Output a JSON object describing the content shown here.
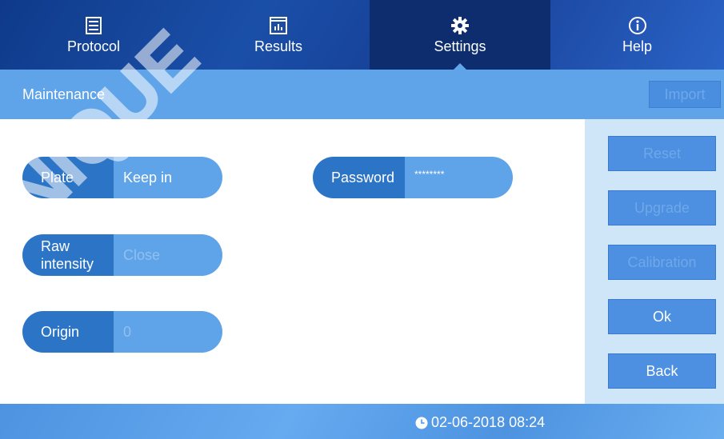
{
  "tabs": [
    {
      "label": "Protocol",
      "icon": "protocol-icon"
    },
    {
      "label": "Results",
      "icon": "results-icon"
    },
    {
      "label": "Settings",
      "icon": "gear-icon",
      "active": true
    },
    {
      "label": "Help",
      "icon": "info-icon"
    }
  ],
  "header": {
    "title": "Maintenance",
    "import_label": "Import"
  },
  "fields": {
    "plate": {
      "label": "Plate",
      "value": "Keep in"
    },
    "raw_intensity": {
      "label": "Raw\nintensity",
      "value": "Close"
    },
    "origin": {
      "label": "Origin",
      "value": "0"
    },
    "password": {
      "label": "Password",
      "value": "********"
    }
  },
  "side_buttons": {
    "reset": "Reset",
    "upgrade": "Upgrade",
    "calibration": "Calibration",
    "ok": "Ok",
    "back": "Back"
  },
  "status": {
    "datetime": "02-06-2018 08:24",
    "clock_icon": "clock-icon"
  },
  "colors": {
    "accent": "#5fa3e8",
    "nav_dark": "#0f3a8a",
    "key": "#2c74c6"
  },
  "watermark_text": "UNIQUE"
}
